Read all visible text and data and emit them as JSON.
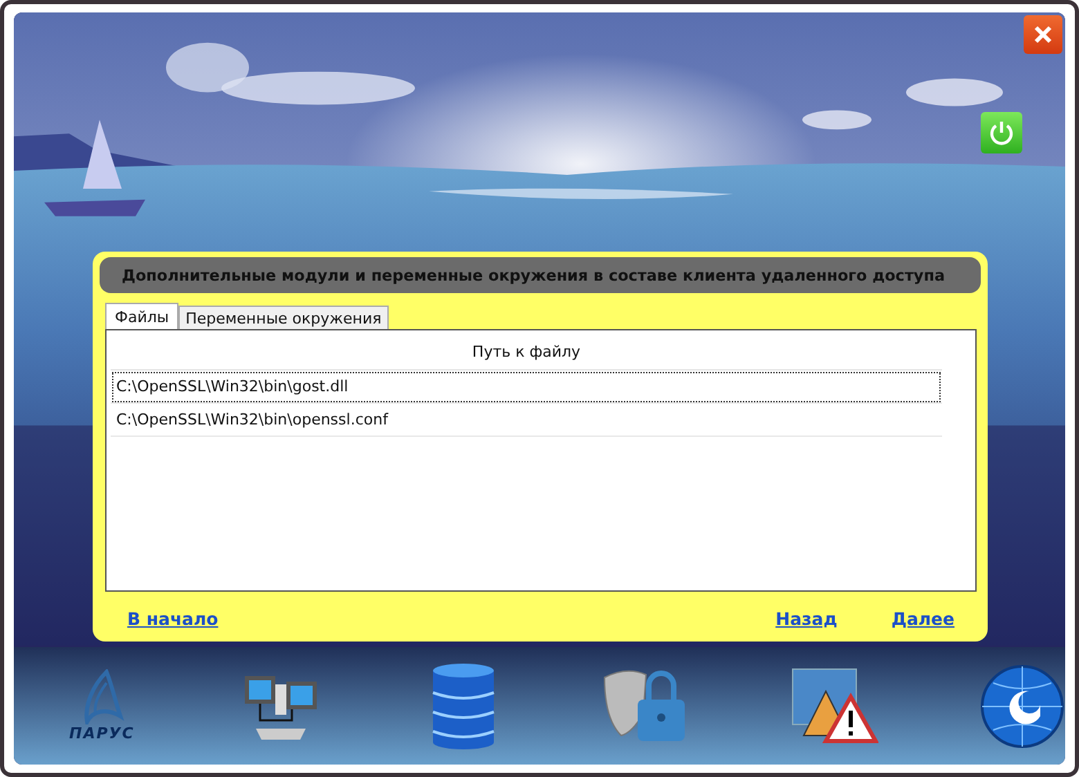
{
  "panel": {
    "title": "Дополнительные модули и переменные окружения в составе клиента удаленного доступа"
  },
  "tabs": [
    {
      "label": "Файлы",
      "selected": true
    },
    {
      "label": "Переменные окружения",
      "selected": false
    }
  ],
  "table": {
    "columns": [
      "Путь к файлу"
    ],
    "rows": [
      {
        "path": "C:\\OpenSSL\\Win32\\bin\\gost.dll",
        "selected": true
      },
      {
        "path": "C:\\OpenSSL\\Win32\\bin\\openssl.conf",
        "selected": false
      }
    ]
  },
  "nav": {
    "start": "В начало",
    "back": "Назад",
    "next": "Далее"
  },
  "footer": {
    "logo_text": "ПАРУС"
  }
}
